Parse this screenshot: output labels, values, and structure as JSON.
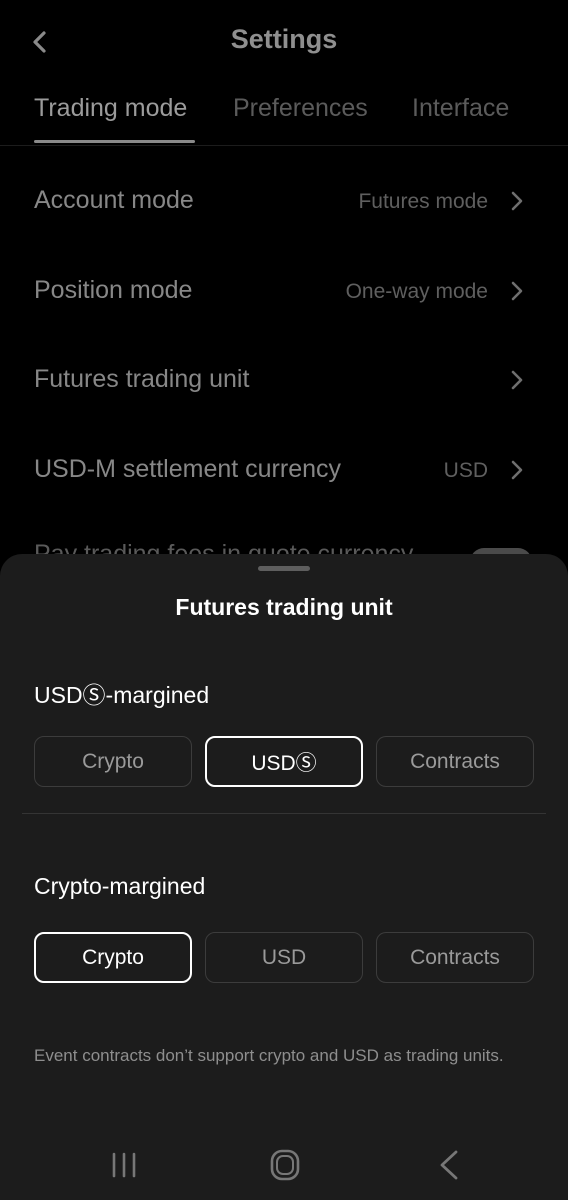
{
  "header": {
    "title": "Settings"
  },
  "tabs": [
    {
      "label": "Trading mode",
      "active": true
    },
    {
      "label": "Preferences",
      "active": false
    },
    {
      "label": "Interface",
      "active": false
    }
  ],
  "settings_rows": [
    {
      "label": "Account mode",
      "value": "Futures mode"
    },
    {
      "label": "Position mode",
      "value": "One-way mode"
    },
    {
      "label": "Futures trading unit",
      "value": ""
    },
    {
      "label": "USD-M settlement currency",
      "value": "USD"
    }
  ],
  "partially_hidden_row": {
    "label": "Pay trading fees in quote currency"
  },
  "sheet": {
    "title": "Futures trading unit",
    "usds_section": {
      "title": "USDⓈ-margined",
      "options": [
        "Crypto",
        "USDⓈ",
        "Contracts"
      ],
      "selected": "USDⓈ"
    },
    "crypto_section": {
      "title": "Crypto-margined",
      "options": [
        "Crypto",
        "USD",
        "Contracts"
      ],
      "selected": "Crypto"
    },
    "note": "Event contracts don’t support crypto and USD as trading units."
  },
  "icons": {
    "back": "back-chevron-icon",
    "row_chevron": "chevron-right-icon",
    "nav_recent": "recent-apps-icon",
    "nav_home": "home-icon",
    "nav_back": "nav-back-icon"
  },
  "colors": {
    "background": "#000000",
    "sheet": "#1c1c1c",
    "selected_border": "#ffffff"
  }
}
